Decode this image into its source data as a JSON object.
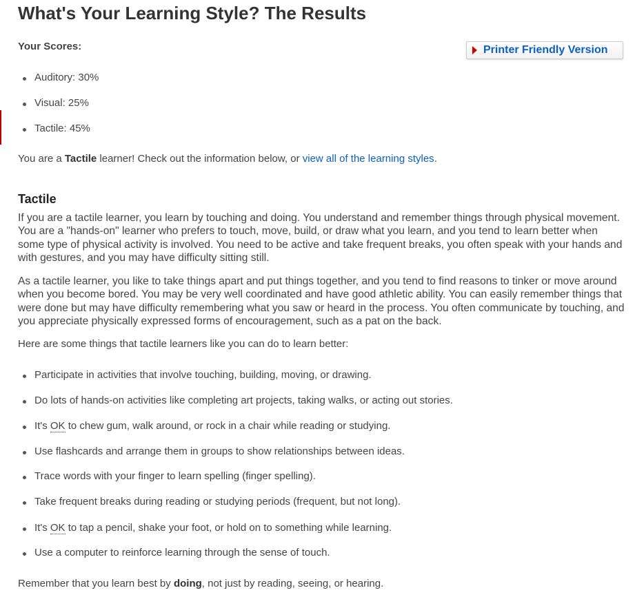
{
  "title": "What's Your Learning Style? The Results",
  "scores_label": "Your Scores:",
  "printer_button": "Printer Friendly Version",
  "scores": [
    "Auditory: 30%",
    "Visual: 25%",
    "Tactile: 45%"
  ],
  "result": {
    "prefix": "You are a ",
    "style": "Tactile",
    "middle": " learner! Check out the information below, or ",
    "link": "view all of the learning styles",
    "suffix": "."
  },
  "section_title": "Tactile",
  "paragraphs": [
    "If you are a tactile learner, you learn by touching and doing. You understand and remember things through physical movement. You are a \"hands-on\" learner who prefers to touch, move, build, or draw what you learn, and you tend to learn better when some type of physical activity is involved. You need to be active and take frequent breaks, you often speak with your hands and with gestures, and you may have difficulty sitting still.",
    "As a tactile learner, you like to take things apart and put things together, and you tend to find reasons to tinker or move around when you become bored. You may be very well coordinated and have good athletic ability. You can easily remember things that were done but may have difficulty remembering what you saw or heard in the process. You often communicate by touching, and you appreciate physically expressed forms of encouragement, such as a pat on the back."
  ],
  "tips_intro": "Here are some things that tactile learners like you can do to learn better:",
  "tips": [
    "Participate in activities that involve touching, building, moving, or drawing.",
    "Do lots of hands-on activities like completing art projects, taking walks, or acting out stories.",
    {
      "pre": "It's ",
      "abbr": "OK",
      "post": " to chew gum, walk around, or rock in a chair while reading or studying."
    },
    "Use flashcards and arrange them in groups to show relationships between ideas.",
    "Trace words with your finger to learn spelling (finger spelling).",
    "Take frequent breaks during reading or studying periods (frequent, but not long).",
    {
      "pre": "It's ",
      "abbr": "OK",
      "post": " to tap a pencil, shake your foot, or hold on to something while learning."
    },
    "Use a computer to reinforce learning through the sense of touch."
  ],
  "closing": {
    "prefix": "Remember that you learn best by ",
    "bold": "doing",
    "suffix": ", not just by reading, seeing, or hearing."
  }
}
